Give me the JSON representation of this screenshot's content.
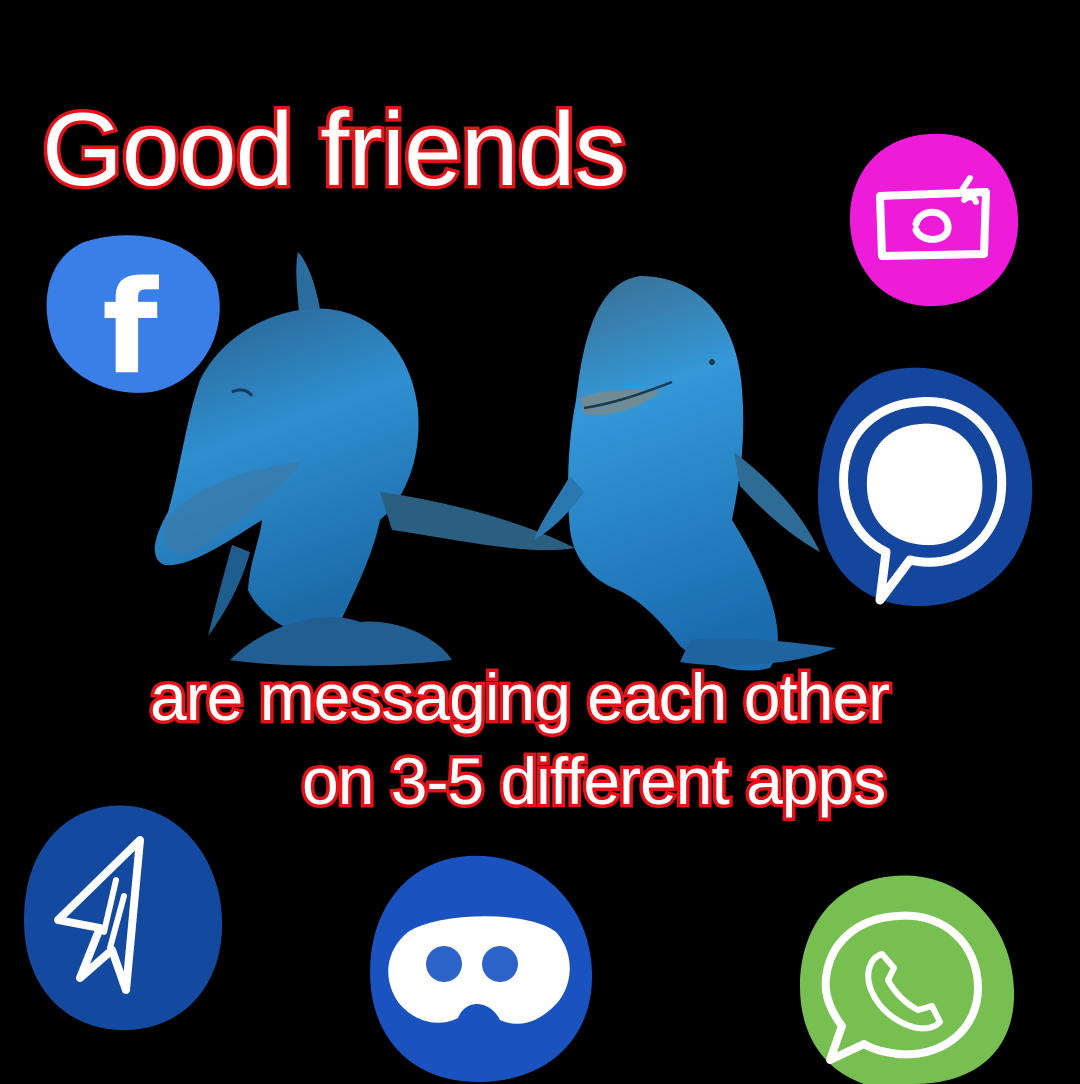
{
  "meme": {
    "title": "Good friends",
    "line1": "are messaging each other",
    "line2": "on 3-5 different apps"
  },
  "icons": {
    "facebook": {
      "glyph": "f",
      "color": "#3a7fe8"
    },
    "instagram": {
      "color": "#ee1bd9"
    },
    "signal": {
      "color": "#14469d"
    },
    "telegram": {
      "color": "#134a9f"
    },
    "discord": {
      "color": "#1a52bf",
      "eye_color": "#2d62c9"
    },
    "whatsapp": {
      "color": "#78bf52"
    }
  },
  "colors": {
    "background": "#000000",
    "caption_fill": "#ffffff",
    "caption_outline": "#e3141a",
    "dolphin": "#2f8fd0"
  }
}
